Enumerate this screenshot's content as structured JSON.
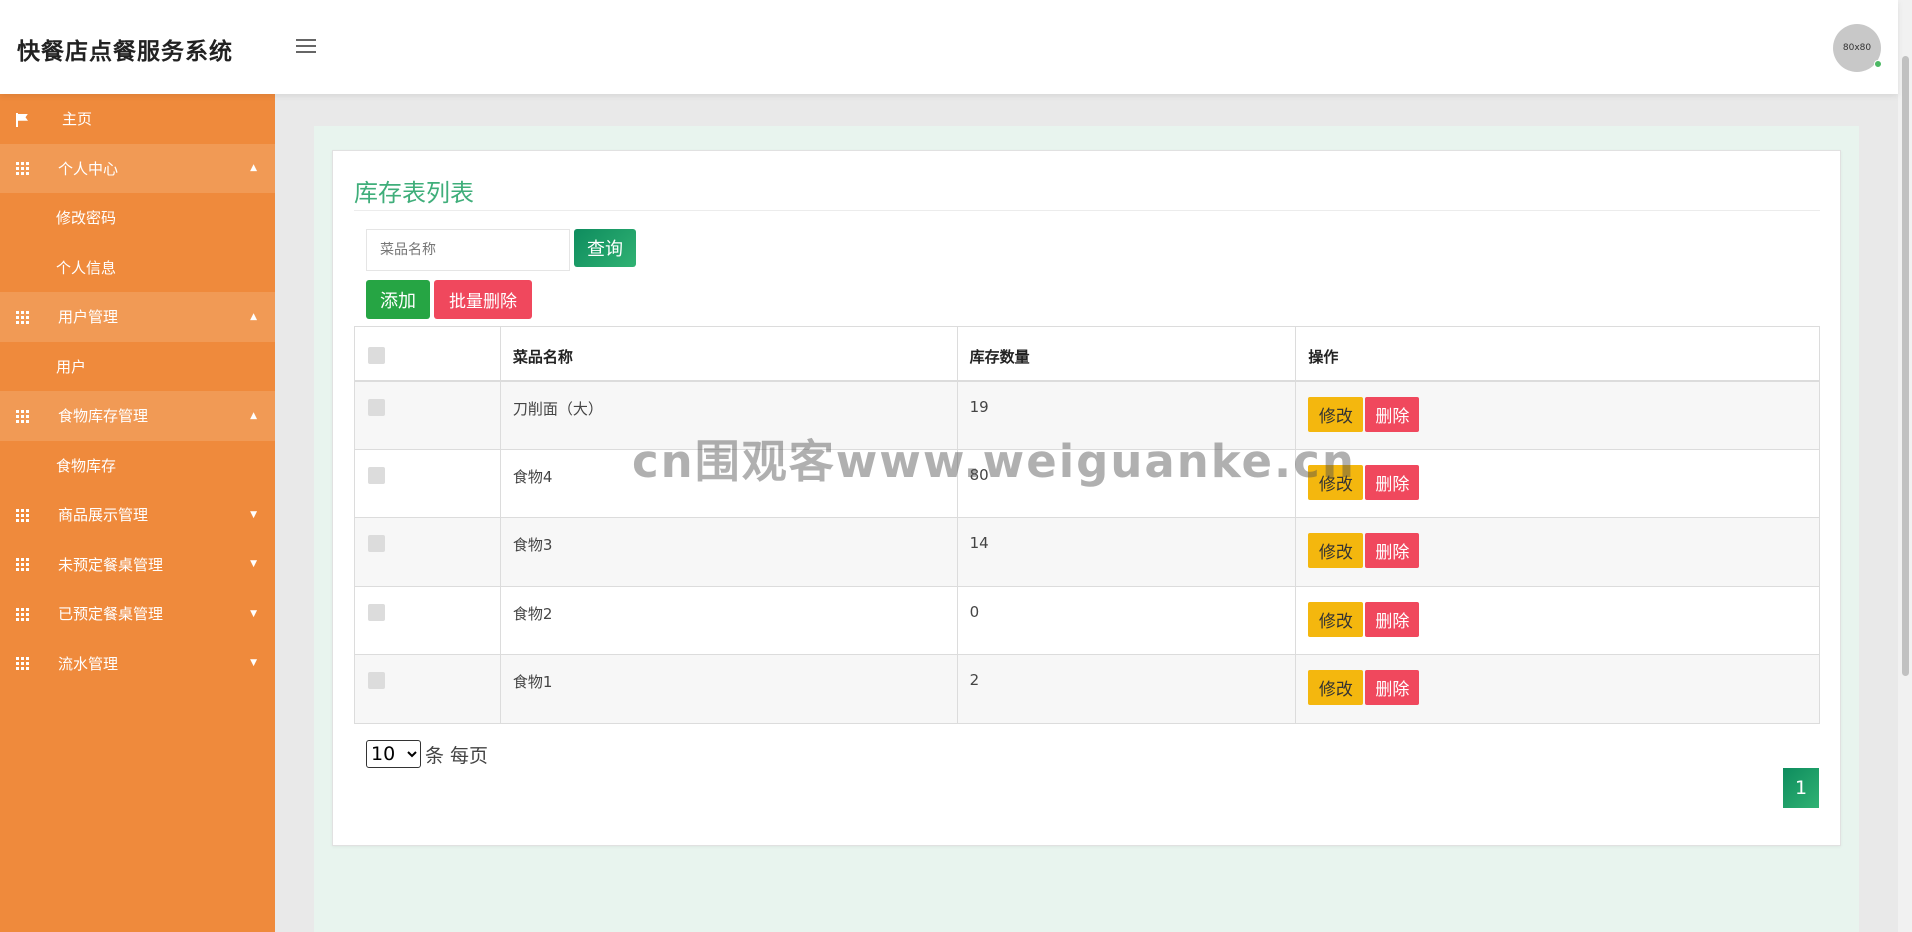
{
  "header": {
    "brand": "快餐店点餐服务系统",
    "menu_icon": "hamburger-icon",
    "avatar_text": "80x80"
  },
  "sidebar": {
    "items": [
      {
        "label": "主页",
        "icon": "flag-icon"
      },
      {
        "label": "个人中心",
        "icon": "grid-icon",
        "caret": "▲",
        "sub": [
          "修改密码",
          "个人信息"
        ]
      },
      {
        "label": "用户管理",
        "icon": "grid-icon",
        "caret": "▲",
        "sub": [
          "用户"
        ]
      },
      {
        "label": "食物库存管理",
        "icon": "grid-icon",
        "caret": "▲",
        "sub": [
          "食物库存"
        ]
      },
      {
        "label": "商品展示管理",
        "icon": "grid-icon",
        "caret": "▼"
      },
      {
        "label": "未预定餐桌管理",
        "icon": "grid-icon",
        "caret": "▼"
      },
      {
        "label": "已预定餐桌管理",
        "icon": "grid-icon",
        "caret": "▼"
      },
      {
        "label": "流水管理",
        "icon": "grid-icon",
        "caret": "▼"
      }
    ]
  },
  "main": {
    "title": "库存表列表",
    "search": {
      "placeholder": "菜品名称",
      "button": "查询"
    },
    "actions": {
      "add": "添加",
      "batch_delete": "批量删除"
    },
    "table": {
      "headers": [
        "菜品名称",
        "库存数量",
        "操作"
      ],
      "rows": [
        {
          "name": "刀削面（大）",
          "qty": "19"
        },
        {
          "name": "食物4",
          "qty": "80"
        },
        {
          "name": "食物3",
          "qty": "14"
        },
        {
          "name": "食物2",
          "qty": "0"
        },
        {
          "name": "食物1",
          "qty": "2"
        }
      ],
      "edit_label": "修改",
      "delete_label": "删除"
    },
    "pagination": {
      "page_size": "10",
      "page_size_suffix": "条 每页",
      "current_page": "1"
    }
  },
  "watermark": "cn围观客www.weiguanke.cn",
  "colors": {
    "sidebar": "#ef8a3c",
    "accent": "#3fae7a",
    "danger": "#f0485d",
    "warning": "#f4b70e",
    "success": "#26a544"
  }
}
